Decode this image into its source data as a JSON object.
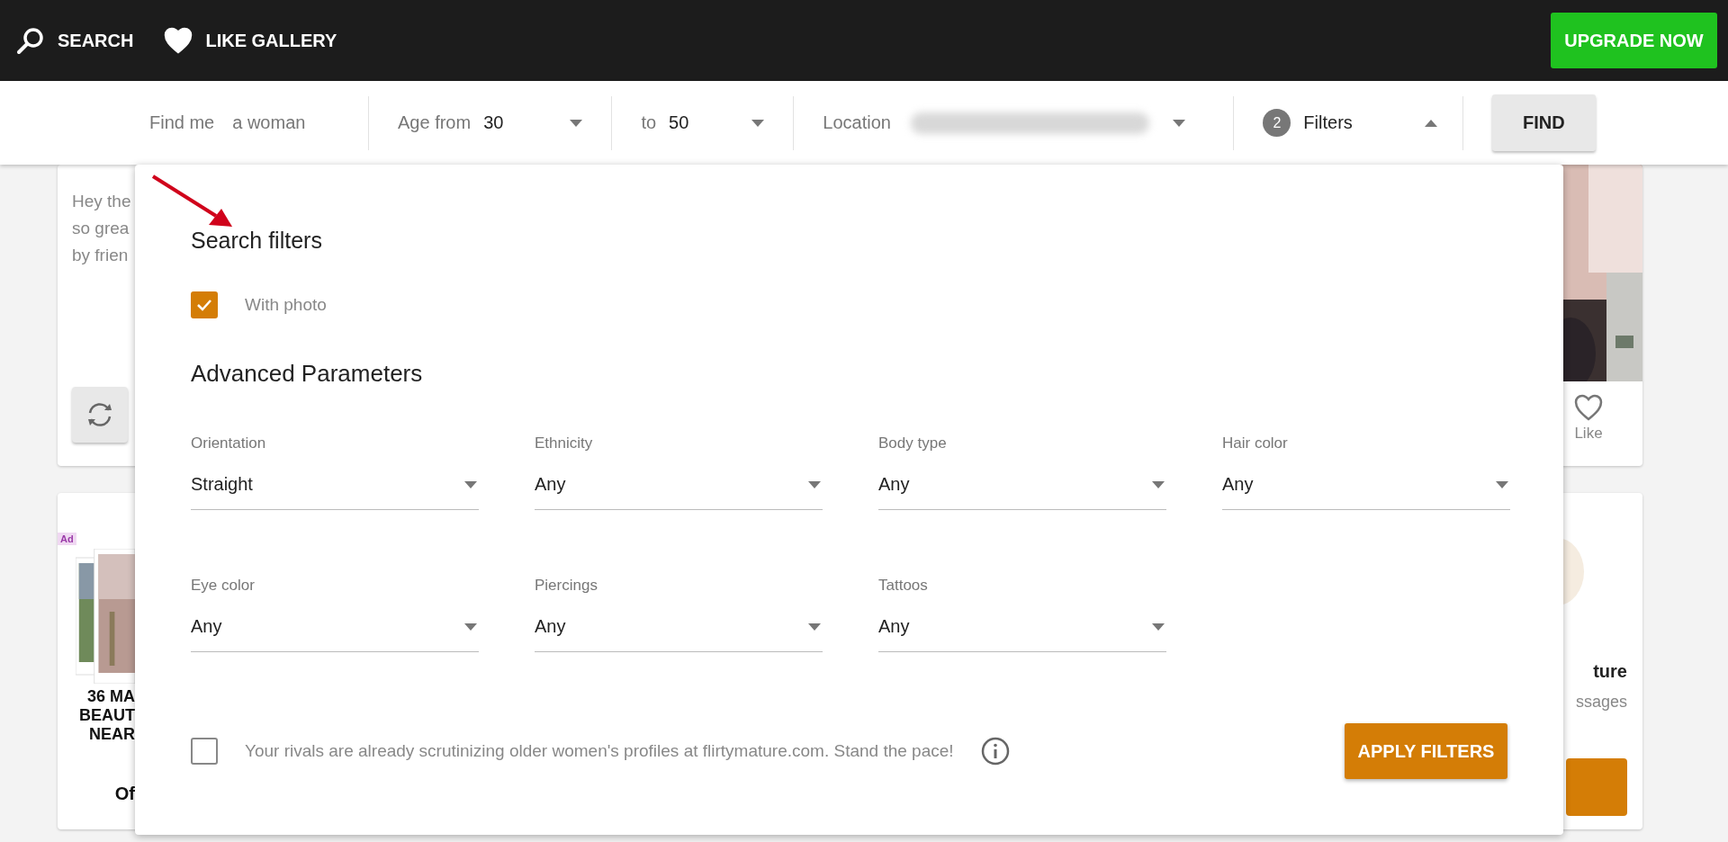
{
  "nav": {
    "items": [
      {
        "kind": "search",
        "label": "SEARCH"
      },
      {
        "kind": "heart",
        "label": "LIKE GALLERY"
      }
    ],
    "upgrade": "UPGRADE NOW"
  },
  "search_bar": {
    "find_label": "Find me",
    "find_value": "a woman",
    "age_from_label": "Age from",
    "age_from": "30",
    "age_to_label": "to",
    "age_to": "50",
    "location_label": "Location",
    "filters_count": "2",
    "filters_label": "Filters",
    "filters_expanded": true,
    "find_button": "FIND"
  },
  "background": {
    "message_lines": [
      "Hey the",
      "so grea",
      "by frien"
    ],
    "ad_badge": "Ad",
    "ad_lines": [
      "36 MA",
      "BEAUT",
      "NEAR"
    ],
    "ad_tail": "Of",
    "like_label": "Like",
    "name": "ture",
    "subtitle": "ssages"
  },
  "filters_panel": {
    "title": "Search filters",
    "with_photo": {
      "label": "With photo",
      "checked": true
    },
    "advanced_title": "Advanced Parameters",
    "fields": [
      {
        "label": "Orientation",
        "value": "Straight"
      },
      {
        "label": "Ethnicity",
        "value": "Any"
      },
      {
        "label": "Body type",
        "value": "Any"
      },
      {
        "label": "Hair color",
        "value": "Any"
      },
      {
        "label": "Eye color",
        "value": "Any"
      },
      {
        "label": "Piercings",
        "value": "Any"
      },
      {
        "label": "Tattoos",
        "value": "Any"
      }
    ],
    "promo": {
      "checked": false,
      "text": "Your rivals are already scrutinizing older women's profiles at flirtymature.com. Stand the pace!"
    },
    "apply_button": "APPLY FILTERS"
  }
}
